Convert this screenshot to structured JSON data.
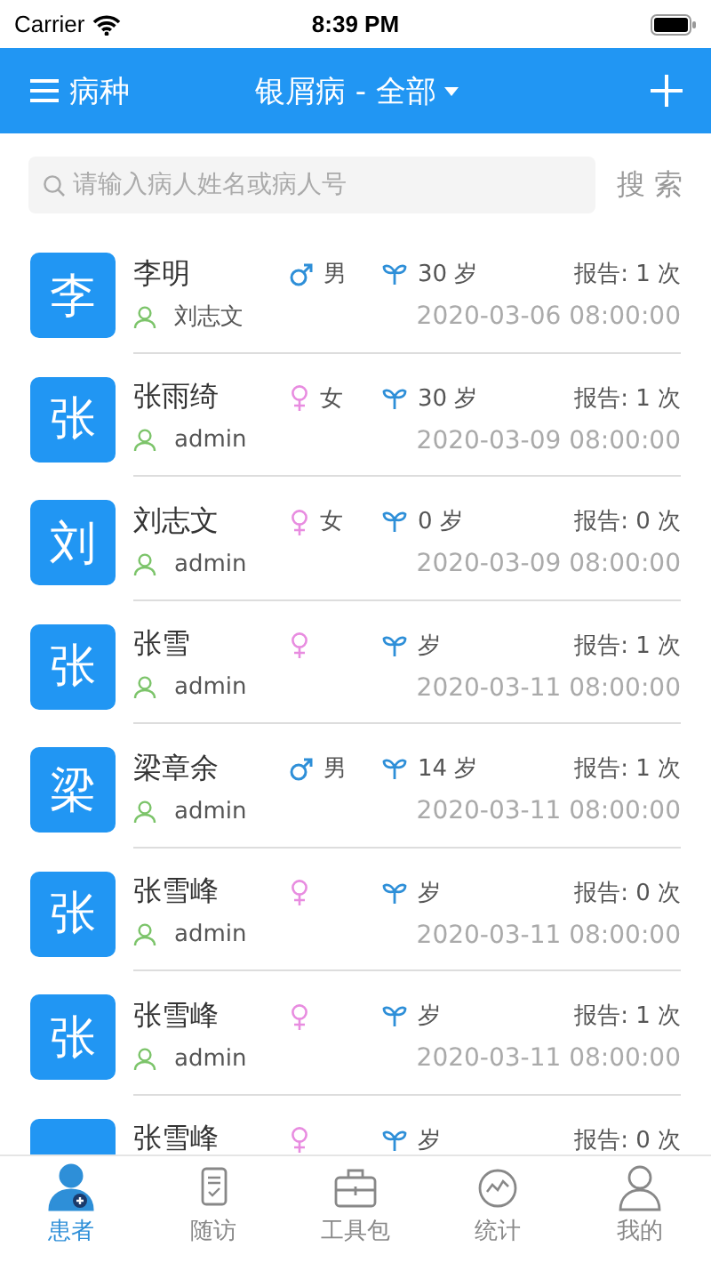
{
  "status_bar": {
    "carrier": "Carrier",
    "time": "8:39 PM"
  },
  "nav": {
    "menu_label": "病种",
    "title": "银屑病 - 全部"
  },
  "search": {
    "placeholder": "请输入病人姓名或病人号",
    "button": "搜 索"
  },
  "patients": [
    {
      "avatar": "李",
      "name": "李明",
      "kind": "male",
      "gender_label": "男",
      "age": "30 岁",
      "reports": "报告: 1 次",
      "doctor": "刘志文",
      "time": "2020-03-06 08:00:00"
    },
    {
      "avatar": "张",
      "name": "张雨绮",
      "kind": "female",
      "gender_label": "女",
      "age": "30 岁",
      "reports": "报告: 1 次",
      "doctor": "admin",
      "time": "2020-03-09 08:00:00"
    },
    {
      "avatar": "刘",
      "name": "刘志文",
      "kind": "female",
      "gender_label": "女",
      "age": "0 岁",
      "reports": "报告: 0 次",
      "doctor": "admin",
      "time": "2020-03-09 08:00:00"
    },
    {
      "avatar": "张",
      "name": "张雪",
      "kind": "female",
      "age": "岁",
      "reports": "报告: 1 次",
      "doctor": "admin",
      "time": "2020-03-11 08:00:00"
    },
    {
      "avatar": "梁",
      "name": "梁章余",
      "kind": "male",
      "gender_label": "男",
      "age": "14 岁",
      "reports": "报告: 1 次",
      "doctor": "admin",
      "time": "2020-03-11 08:00:00"
    },
    {
      "avatar": "张",
      "name": "张雪峰",
      "kind": "female",
      "age": "岁",
      "reports": "报告: 0 次",
      "doctor": "admin",
      "time": "2020-03-11 08:00:00"
    },
    {
      "avatar": "张",
      "name": "张雪峰",
      "kind": "female",
      "age": "岁",
      "reports": "报告: 1 次",
      "doctor": "admin",
      "time": "2020-03-11 08:00:00"
    },
    {
      "name": "张雪峰",
      "kind": "female",
      "age": "岁",
      "reports": "报告: 0 次"
    }
  ],
  "tabs": [
    {
      "kind": "patients",
      "label": "患者",
      "selected": true
    },
    {
      "kind": "followup",
      "label": "随访",
      "selected": false
    },
    {
      "kind": "toolkit",
      "label": "工具包",
      "selected": false
    },
    {
      "kind": "stats",
      "label": "统计",
      "selected": false
    },
    {
      "kind": "me",
      "label": "我的",
      "selected": false
    }
  ]
}
